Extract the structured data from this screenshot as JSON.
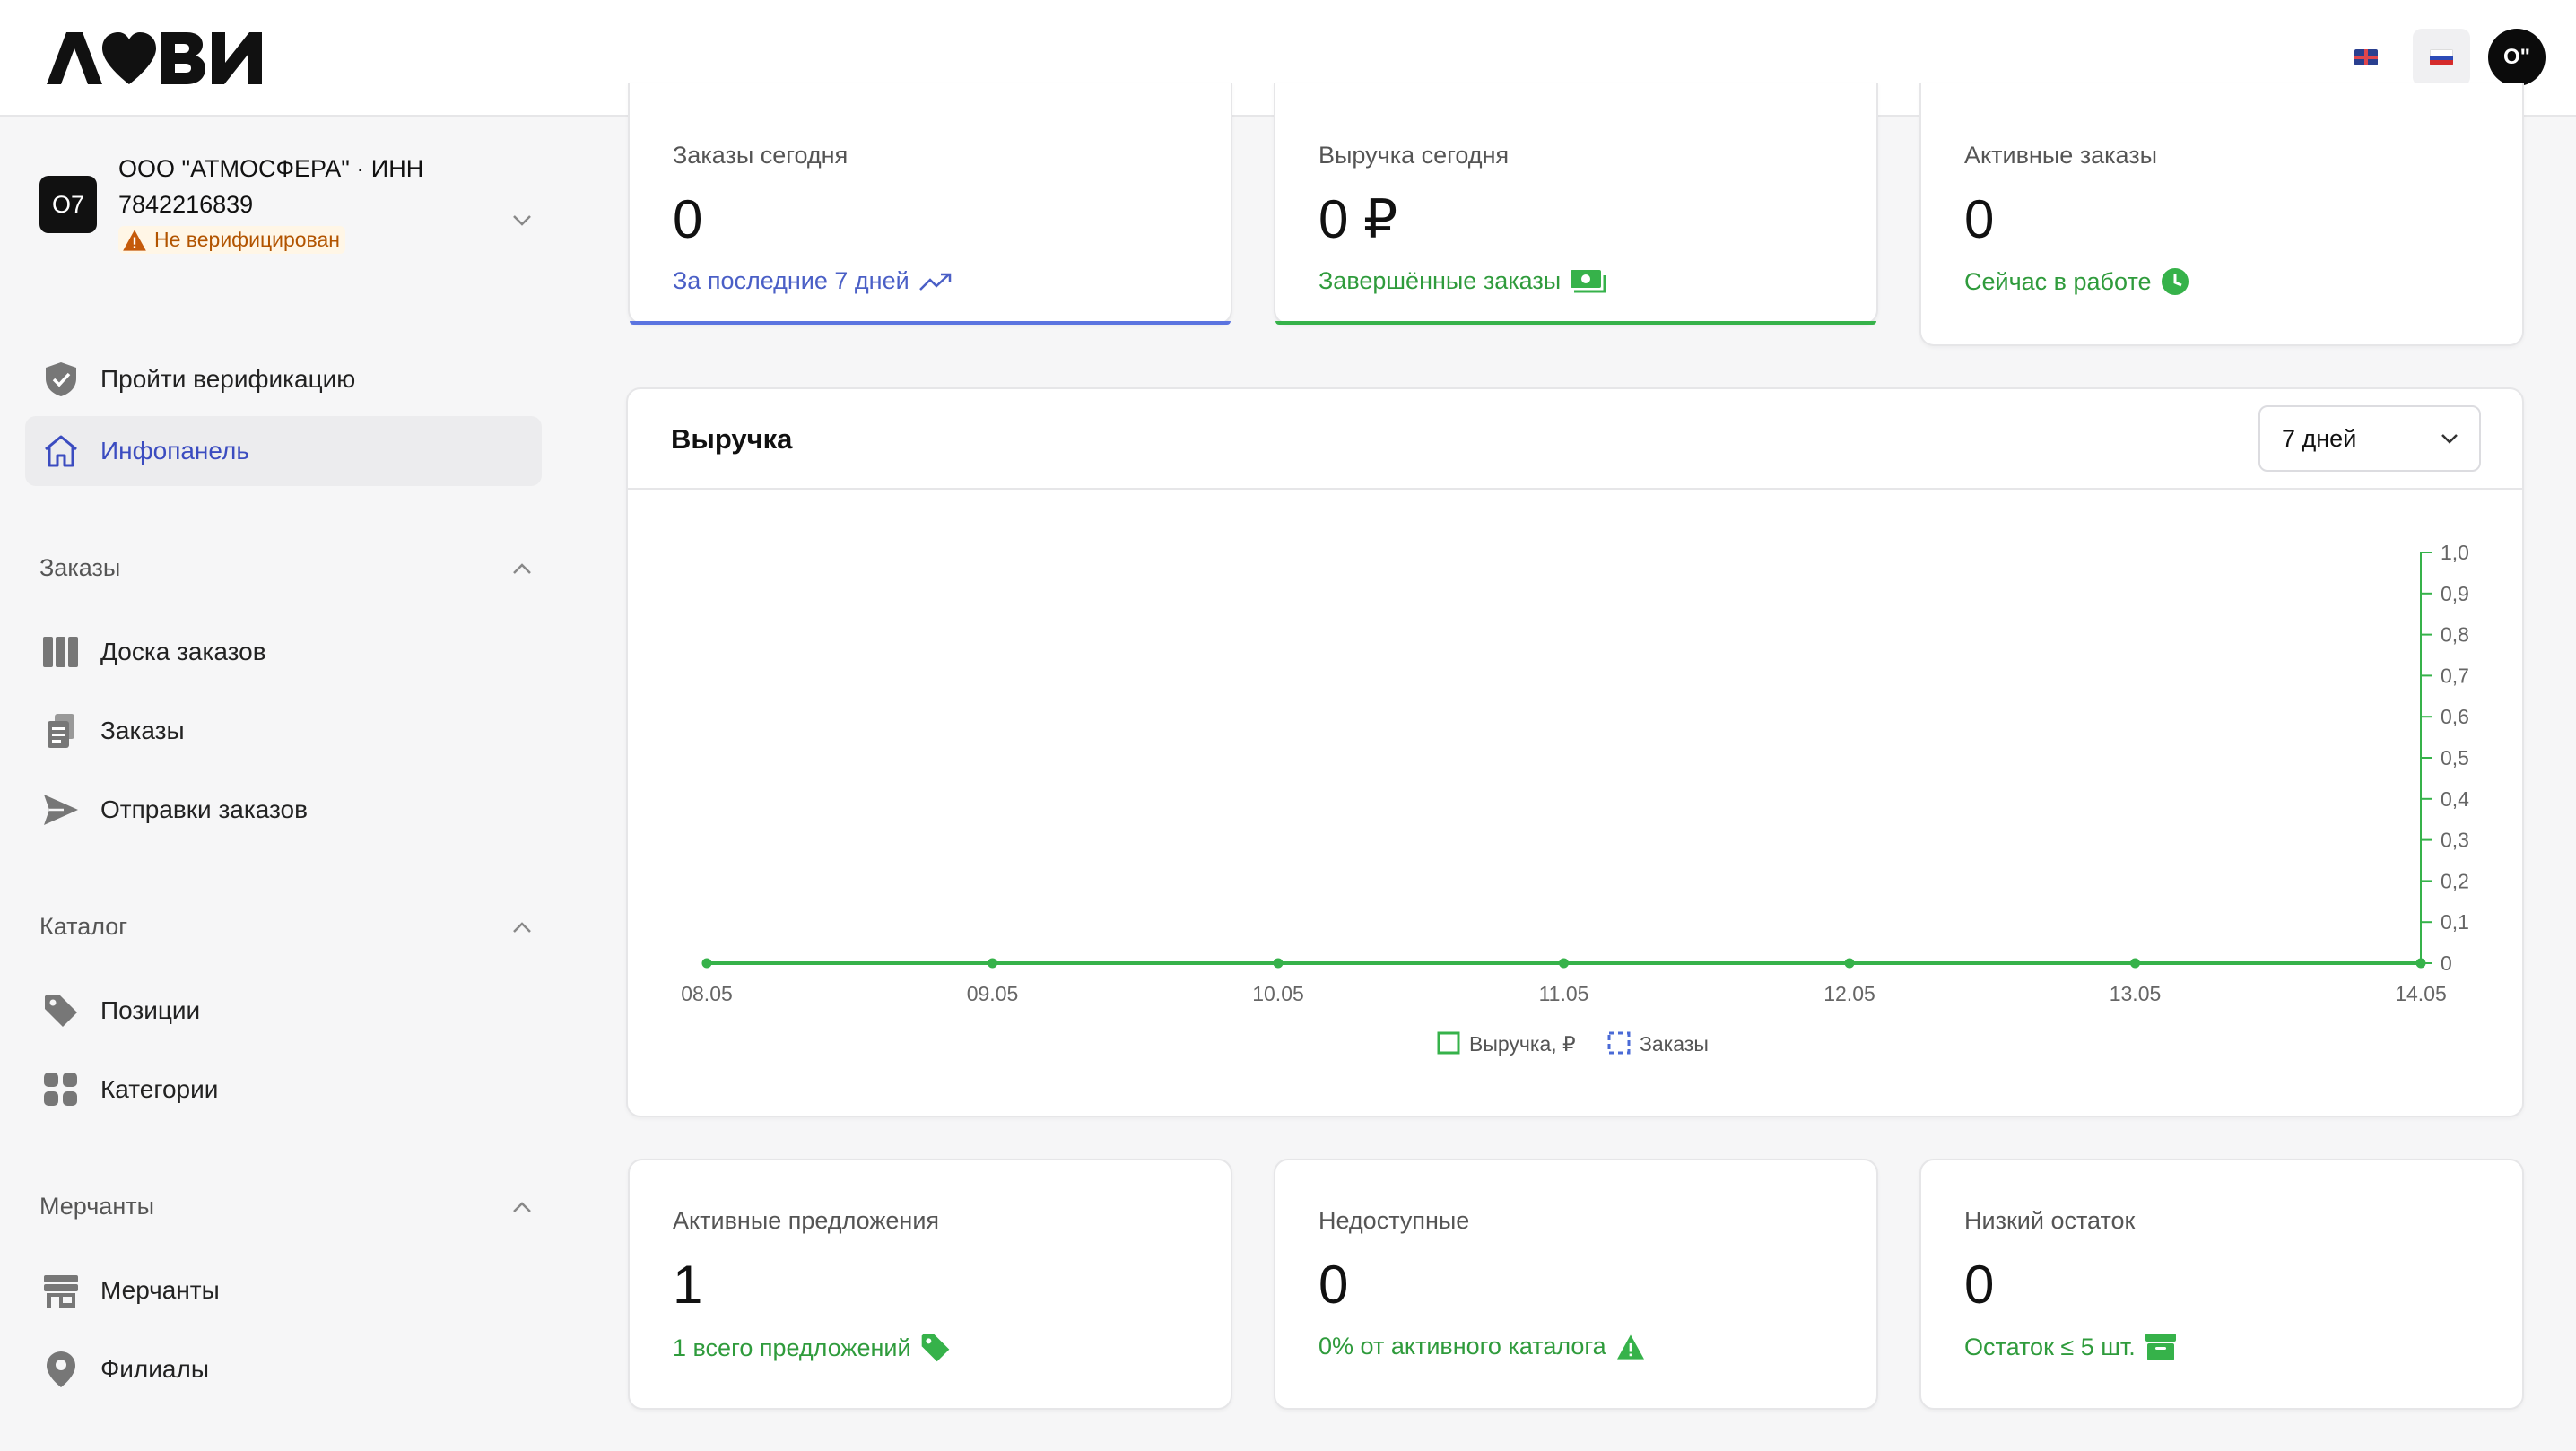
{
  "header": {
    "logo_text": "ЛОВИ",
    "lang_en_icon": "uk-flag-icon",
    "lang_ru_icon": "ru-flag-icon",
    "avatar_text": "O\""
  },
  "company": {
    "badge": "O7",
    "name": "ООО \"АТМОСФЕРА\" · ИНН 7842216839",
    "status": "Не верифицирован",
    "status_color": "#b25400"
  },
  "sidebar": {
    "verify": "Пройти верификацию",
    "dashboard": "Инфопанель",
    "sections": [
      {
        "title": "Заказы",
        "items": [
          "Доска заказов",
          "Заказы",
          "Отправки заказов"
        ]
      },
      {
        "title": "Каталог",
        "items": [
          "Позиции",
          "Категории"
        ]
      },
      {
        "title": "Мерчанты",
        "items": [
          "Мерчанты",
          "Филиалы"
        ]
      }
    ]
  },
  "stats_top": [
    {
      "label": "Заказы сегодня",
      "value": "0",
      "sub": "За последние 7 дней",
      "sub_icon": "trending-up-icon",
      "accent": "#4a5fc6"
    },
    {
      "label": "Выручка сегодня",
      "value": "0 ₽",
      "sub": "Завершённые заказы",
      "sub_icon": "cash-icon",
      "accent": "#2f9b3c"
    },
    {
      "label": "Активные заказы",
      "value": "0",
      "sub": "Сейчас в работе",
      "sub_icon": "clock-icon",
      "accent": "#2f9b3c"
    }
  ],
  "chart_panel": {
    "title": "Выручка",
    "period": "7 дней"
  },
  "chart_data": {
    "type": "line",
    "categories": [
      "08.05",
      "09.05",
      "10.05",
      "11.05",
      "12.05",
      "13.05",
      "14.05"
    ],
    "series": [
      {
        "name": "Выручка, ₽",
        "values": [
          0,
          0,
          0,
          0,
          0,
          0,
          0
        ],
        "color": "#36b24a"
      },
      {
        "name": "Заказы",
        "values": [
          0,
          0,
          0,
          0,
          0,
          0,
          0
        ],
        "color": "#4a6ad6"
      }
    ],
    "y_ticks": [
      "0",
      "0,1",
      "0,2",
      "0,3",
      "0,4",
      "0,5",
      "0,6",
      "0,7",
      "0,8",
      "0,9",
      "1,0"
    ],
    "ylim": [
      0,
      1
    ],
    "y_axis_side": "right",
    "grid": false,
    "legend_position": "bottom-center"
  },
  "stats_bottom": [
    {
      "label": "Активные предложения",
      "value": "1",
      "sub": "1 всего предложений",
      "sub_icon": "tag-icon"
    },
    {
      "label": "Недоступные",
      "value": "0",
      "sub": "0% от активного каталога",
      "sub_icon": "warning-icon"
    },
    {
      "label": "Низкий остаток",
      "value": "0",
      "sub": "Остаток ≤ 5 шт.",
      "sub_icon": "archive-icon"
    }
  ]
}
